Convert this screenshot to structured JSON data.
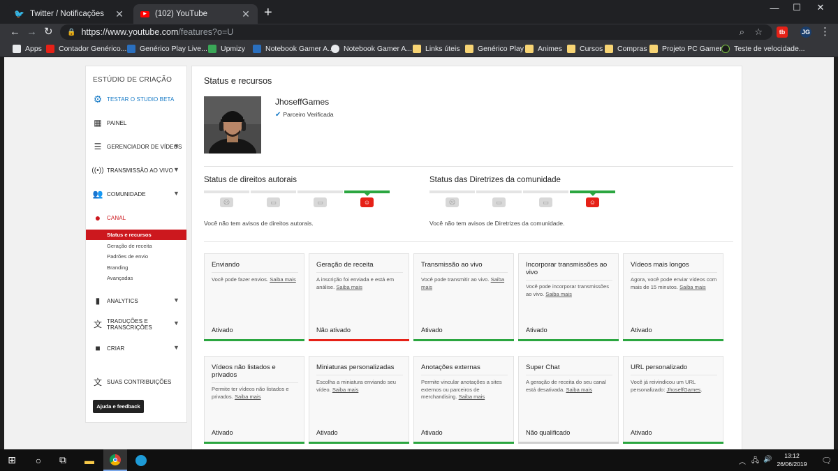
{
  "browser": {
    "tabs": [
      {
        "label": "Twitter / Notificações",
        "icon": "twitter-icon"
      },
      {
        "label": "(102) YouTube",
        "icon": "youtube-icon"
      }
    ],
    "url_host": "https://www.youtube.com",
    "url_path": "/features?o=U",
    "bookmarks": [
      {
        "label": "Apps",
        "icon": "apps-grid-icon"
      },
      {
        "label": "Contador Genérico...",
        "icon": "red-counter-icon"
      },
      {
        "label": "Genérico Play Live...",
        "icon": "blue-app-icon"
      },
      {
        "label": "Upmizy",
        "icon": "upmizy-icon"
      },
      {
        "label": "Notebook Gamer A...",
        "icon": "blue-app-icon"
      },
      {
        "label": "Notebook Gamer A...",
        "icon": "globe-icon"
      },
      {
        "label": "Links úteis",
        "icon": "folder-icon"
      },
      {
        "label": "Genérico Play",
        "icon": "folder-icon"
      },
      {
        "label": "Animes",
        "icon": "folder-icon"
      },
      {
        "label": "Cursos",
        "icon": "folder-icon"
      },
      {
        "label": "Compras",
        "icon": "folder-icon"
      },
      {
        "label": "Projeto PC Gamer",
        "icon": "folder-icon"
      },
      {
        "label": "Teste de velocidade...",
        "icon": "speedtest-icon"
      }
    ]
  },
  "sidebar": {
    "title": "ESTÚDIO DE CRIAÇÃO",
    "items": [
      {
        "label": "TESTAR O STUDIO BETA",
        "icon": "gear-icon"
      },
      {
        "label": "PAINEL",
        "icon": "dashboard-icon"
      },
      {
        "label": "GERENCIADOR DE VÍDEOS",
        "icon": "video-manager-icon"
      },
      {
        "label": "TRANSMISSÃO AO VIVO",
        "icon": "live-broadcast-icon"
      },
      {
        "label": "COMUNIDADE",
        "icon": "community-icon"
      },
      {
        "label": "CANAL",
        "icon": "channel-icon"
      },
      {
        "label": "ANALYTICS",
        "icon": "analytics-icon"
      },
      {
        "label": "TRADUÇÕES E TRANSCRIÇÕES",
        "icon": "translate-icon"
      },
      {
        "label": "CRIAR",
        "icon": "camera-icon"
      },
      {
        "label": "SUAS CONTRIBUIÇÕES",
        "icon": "contributions-icon"
      }
    ],
    "channel_subitems": [
      "Status e recursos",
      "Geração de receita",
      "Padrões de envio",
      "Branding",
      "Avançadas"
    ],
    "help_button": "Ajuda e feedback"
  },
  "main": {
    "title": "Status e recursos",
    "channel_name": "JhoseffGames",
    "verified_label": "Parceiro Verificada",
    "copyright": {
      "title": "Status de direitos autorais",
      "message": "Você não tem avisos de direitos autorais.",
      "active_level": 4
    },
    "community": {
      "title": "Status das Diretrizes da comunidade",
      "message": "Você não tem avisos de Diretrizes da comunidade.",
      "active_level": 4
    },
    "features": [
      {
        "title": "Enviando",
        "desc": "Você pode fazer envios.",
        "link": "Saiba mais",
        "status": "Ativado",
        "bar_color": "#2ba640"
      },
      {
        "title": "Geração de receita",
        "desc": "A inscrição foi enviada e está em análise.",
        "link": "Saiba mais",
        "status": "Não ativado",
        "bar_color": "#e62117"
      },
      {
        "title": "Transmissão ao vivo",
        "desc": "Você pode transmitir ao vivo.",
        "link": "Saiba mais",
        "status": "Ativado",
        "bar_color": "#2ba640"
      },
      {
        "title": "Incorporar transmissões ao vivo",
        "desc": "Você pode incorporar transmissões ao vivo.",
        "link": "Saiba mais",
        "status": "Ativado",
        "bar_color": "#2ba640"
      },
      {
        "title": "Vídeos mais longos",
        "desc": "Agora, você pode enviar vídeos com mais de 15 minutos.",
        "link": "Saiba mais",
        "status": "Ativado",
        "bar_color": "#2ba640"
      },
      {
        "title": "Vídeos não listados e privados",
        "desc": "Permite ter vídeos não listados e privados.",
        "link": "Saiba mais",
        "status": "Ativado",
        "bar_color": "#2ba640"
      },
      {
        "title": "Miniaturas personalizadas",
        "desc": "Escolha a miniatura enviando seu vídeo.",
        "link": "Saiba mais",
        "status": "Ativado",
        "bar_color": "#2ba640"
      },
      {
        "title": "Anotações externas",
        "desc": "Permite vincular anotações a sites externos ou parceiros de merchandising.",
        "link": "Saiba mais",
        "status": "Ativado",
        "bar_color": "#2ba640"
      },
      {
        "title": "Super Chat",
        "desc": "A geração de receita do seu canal está desativada.",
        "link": "Saiba mais",
        "status": "Não qualificado",
        "bar_color": "#d0d0d0"
      },
      {
        "title": "URL personalizado",
        "desc": "Você já reivindicou um URL personalizado:",
        "link": "JhoseffGames",
        "suffix": ".",
        "status": "Ativado",
        "bar_color": "#2ba640"
      }
    ]
  },
  "taskbar": {
    "time": "13:12",
    "date": "26/06/2019"
  }
}
